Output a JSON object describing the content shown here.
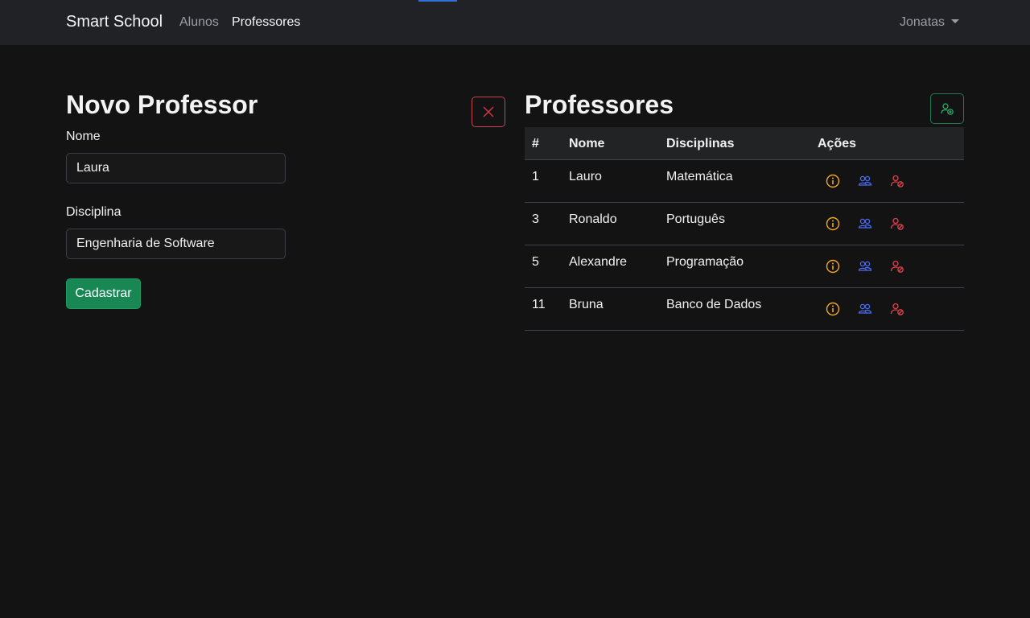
{
  "navbar": {
    "brand": "Smart School",
    "links": [
      {
        "label": "Alunos"
      },
      {
        "label": "Professores"
      }
    ],
    "user": "Jonatas"
  },
  "form": {
    "title": "Novo Professor",
    "nome_label": "Nome",
    "nome_value": "Laura",
    "disciplina_label": "Disciplina",
    "disciplina_value": "Engenharia de Software",
    "submit_label": "Cadastrar"
  },
  "list": {
    "title": "Professores",
    "headers": {
      "id": "#",
      "nome": "Nome",
      "disciplinas": "Disciplinas",
      "acoes": "Ações"
    },
    "rows": [
      {
        "id": "1",
        "nome": "Lauro",
        "disciplina": "Matemática"
      },
      {
        "id": "3",
        "nome": "Ronaldo",
        "disciplina": "Português"
      },
      {
        "id": "5",
        "nome": "Alexandre",
        "disciplina": "Programação"
      },
      {
        "id": "11",
        "nome": "Bruna",
        "disciplina": "Banco de Dados"
      }
    ],
    "row_actions": [
      "info-icon",
      "people-icon",
      "person-remove-icon"
    ]
  },
  "colors": {
    "accent": "#2f6fd6",
    "success": "#198754",
    "danger": "#dc3545",
    "warning": "#f0a92a",
    "info": "#4a6cf7",
    "background": "#131313",
    "navbar": "#202226"
  }
}
